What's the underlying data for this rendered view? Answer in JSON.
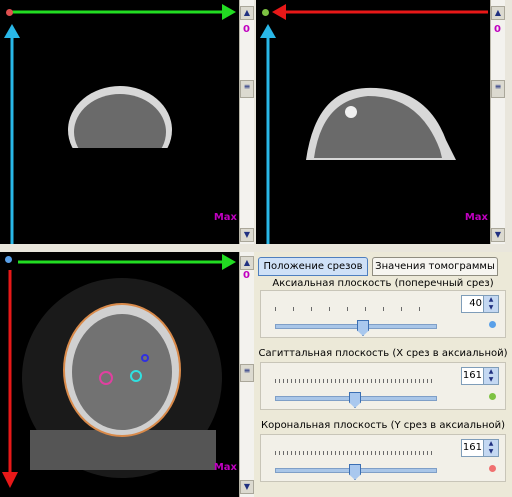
{
  "views": {
    "axial_label_zero": "",
    "top_left": {
      "zero": "0",
      "max": "Max"
    },
    "top_right": {
      "zero": "0",
      "max": "Max"
    },
    "bottom_left": {
      "zero": "0",
      "max": "Max"
    }
  },
  "tabs": {
    "slice_position": "Положение срезов",
    "tomogram_values": "Значения томограммы"
  },
  "axial": {
    "label": "Аксиальная плоскость (поперечный срез)",
    "value": "40",
    "position": 0.55,
    "color": "#5aa0e8"
  },
  "sagittal": {
    "label": "Сагиттальная плоскость (X срез в аксиальной)",
    "value": "161",
    "position": 0.5,
    "color": "#7dc242"
  },
  "coronal": {
    "label": "Корональная плоскость (Y срез в аксиальной)",
    "value": "161",
    "position": 0.5,
    "color": "#f07070"
  },
  "colors": {
    "green_arrow": "#22dd22",
    "cyan_arrow": "#29b8e8",
    "red_arrow": "#e81818",
    "label_magenta": "#c000c0"
  }
}
